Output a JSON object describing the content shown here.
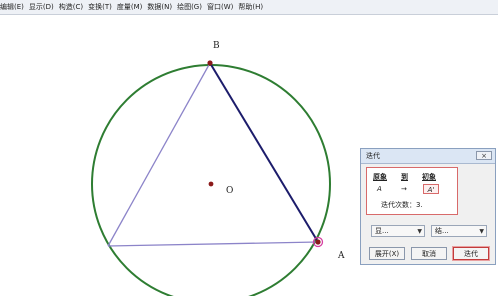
{
  "menu": [
    "编辑(E)",
    "显示(D)",
    "构造(C)",
    "变换(T)",
    "度量(M)",
    "数据(N)",
    "绘图(G)",
    "窗口(W)",
    "帮助(H)"
  ],
  "canvas": {
    "labels": {
      "b": "B",
      "o": "O",
      "a": "A"
    },
    "colors": {
      "circle": "#2e7d32",
      "triangle_light": "#8c84c9",
      "triangle_dark": "#1c1c6b",
      "point": "#8b1a1a",
      "point_a_ring": "#d63fa3"
    }
  },
  "dialog": {
    "title": "迭代",
    "close": "×",
    "headers": {
      "preimage": "原象",
      "to": "到",
      "image": "初象"
    },
    "mapping": {
      "from": "A",
      "arrow": "→",
      "to": "A'"
    },
    "iterations": "迭代次数：3.",
    "dropdowns": {
      "left": "显...",
      "right": "结..."
    },
    "buttons": {
      "expand": "展开(X)",
      "cancel": "取消",
      "iterate": "迭代"
    }
  }
}
